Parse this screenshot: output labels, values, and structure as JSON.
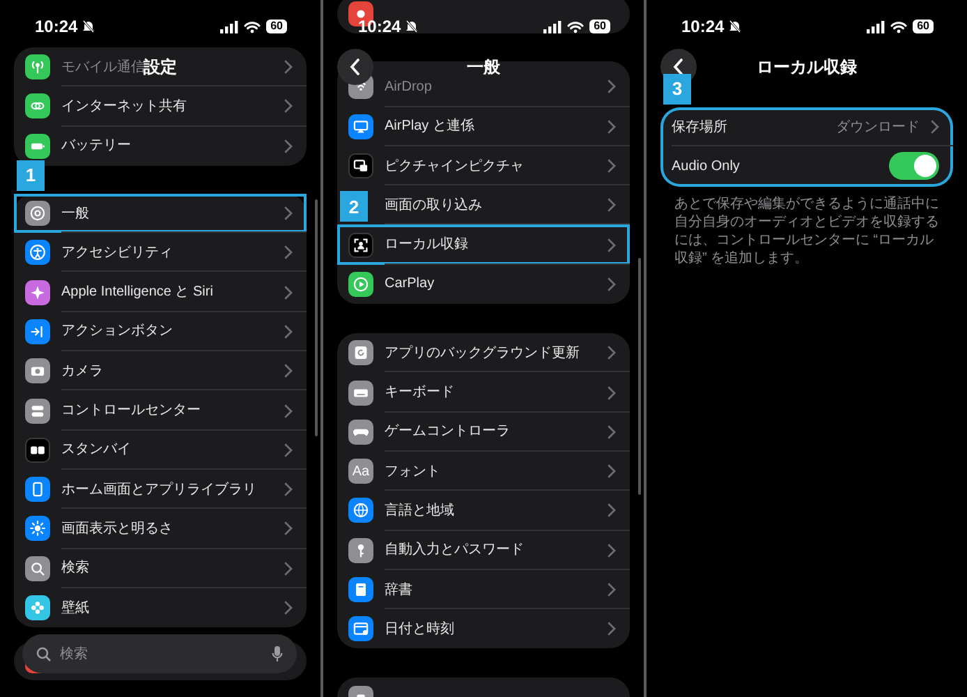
{
  "panels": [
    {
      "status_bar": {
        "time": "10:24",
        "battery": "60"
      },
      "header": {
        "title": "設定"
      },
      "groups": [
        {
          "items": [
            {
              "label": "モバイル通信",
              "color": "#34c759"
            },
            {
              "label": "インターネット共有",
              "color": "#34c759"
            },
            {
              "label": "バッテリー",
              "color": "#34c759"
            }
          ]
        },
        {
          "items": [
            {
              "label": "一般",
              "color": "#8e8e93",
              "callout": "1"
            },
            {
              "label": "アクセシビリティ",
              "color": "#0a84ff"
            },
            {
              "label": "Apple Intelligence と Siri",
              "color": "#c86be0"
            },
            {
              "label": "アクションボタン",
              "color": "#0a84ff"
            },
            {
              "label": "カメラ",
              "color": "#8e8e93"
            },
            {
              "label": "コントロールセンター",
              "color": "#8e8e93"
            },
            {
              "label": "スタンバイ",
              "color": "#000000"
            },
            {
              "label": "ホーム画面とアプリライブラリ",
              "color": "#0a84ff"
            },
            {
              "label": "画面表示と明るさ",
              "color": "#0a84ff"
            },
            {
              "label": "検索",
              "color": "#8e8e93"
            },
            {
              "label": "壁紙",
              "color": "#32c5e6"
            }
          ]
        },
        {
          "items": [
            {
              "color": "#e5443a"
            }
          ]
        }
      ],
      "search": {
        "placeholder": "検索"
      }
    },
    {
      "status_bar": {
        "time": "10:24",
        "battery": "60"
      },
      "header": {
        "title": "一般",
        "back": true
      },
      "groups": [
        {
          "items": [
            {
              "color": "#e5443a"
            }
          ]
        },
        {
          "items": [
            {
              "label": "AirDrop",
              "color": "#8e8e93"
            },
            {
              "label": "AirPlay と連係",
              "color": "#0a84ff"
            },
            {
              "label": "ピクチャインピクチャ",
              "color": "#000000"
            },
            {
              "label": "画面の取り込み"
            },
            {
              "label": "ローカル収録",
              "color": "#000000",
              "callout": "2"
            },
            {
              "label": "CarPlay",
              "color": "#34c759"
            }
          ]
        },
        {
          "items": [
            {
              "label": "アプリのバックグラウンド更新",
              "color": "#8e8e93"
            },
            {
              "label": "キーボード",
              "color": "#8e8e93"
            },
            {
              "label": "ゲームコントローラ",
              "color": "#8e8e93"
            },
            {
              "label": "フォント",
              "color": "#8e8e93",
              "icon_text": "Aa"
            },
            {
              "label": "言語と地域",
              "color": "#0a84ff"
            },
            {
              "label": "自動入力とパスワード",
              "color": "#8e8e93"
            },
            {
              "label": "辞書",
              "color": "#0a84ff"
            },
            {
              "label": "日付と時刻",
              "color": "#0a84ff"
            }
          ]
        },
        {
          "items": [
            {
              "color": "#8e8e93"
            }
          ]
        }
      ]
    },
    {
      "status_bar": {
        "time": "10:24",
        "battery": "60"
      },
      "header": {
        "title": "ローカル収録",
        "back": true
      },
      "groups": [
        {
          "callout": "3",
          "items": [
            {
              "kind": "link",
              "label": "保存場所",
              "value": "ダウンロード"
            },
            {
              "kind": "toggle",
              "label": "Audio Only",
              "on": true
            }
          ],
          "footer": "あとで保存や編集ができるように通話中に自分自身のオーディオとビデオを収録するには、コントロールセンターに “ローカル収録” を追加します。"
        }
      ]
    }
  ]
}
